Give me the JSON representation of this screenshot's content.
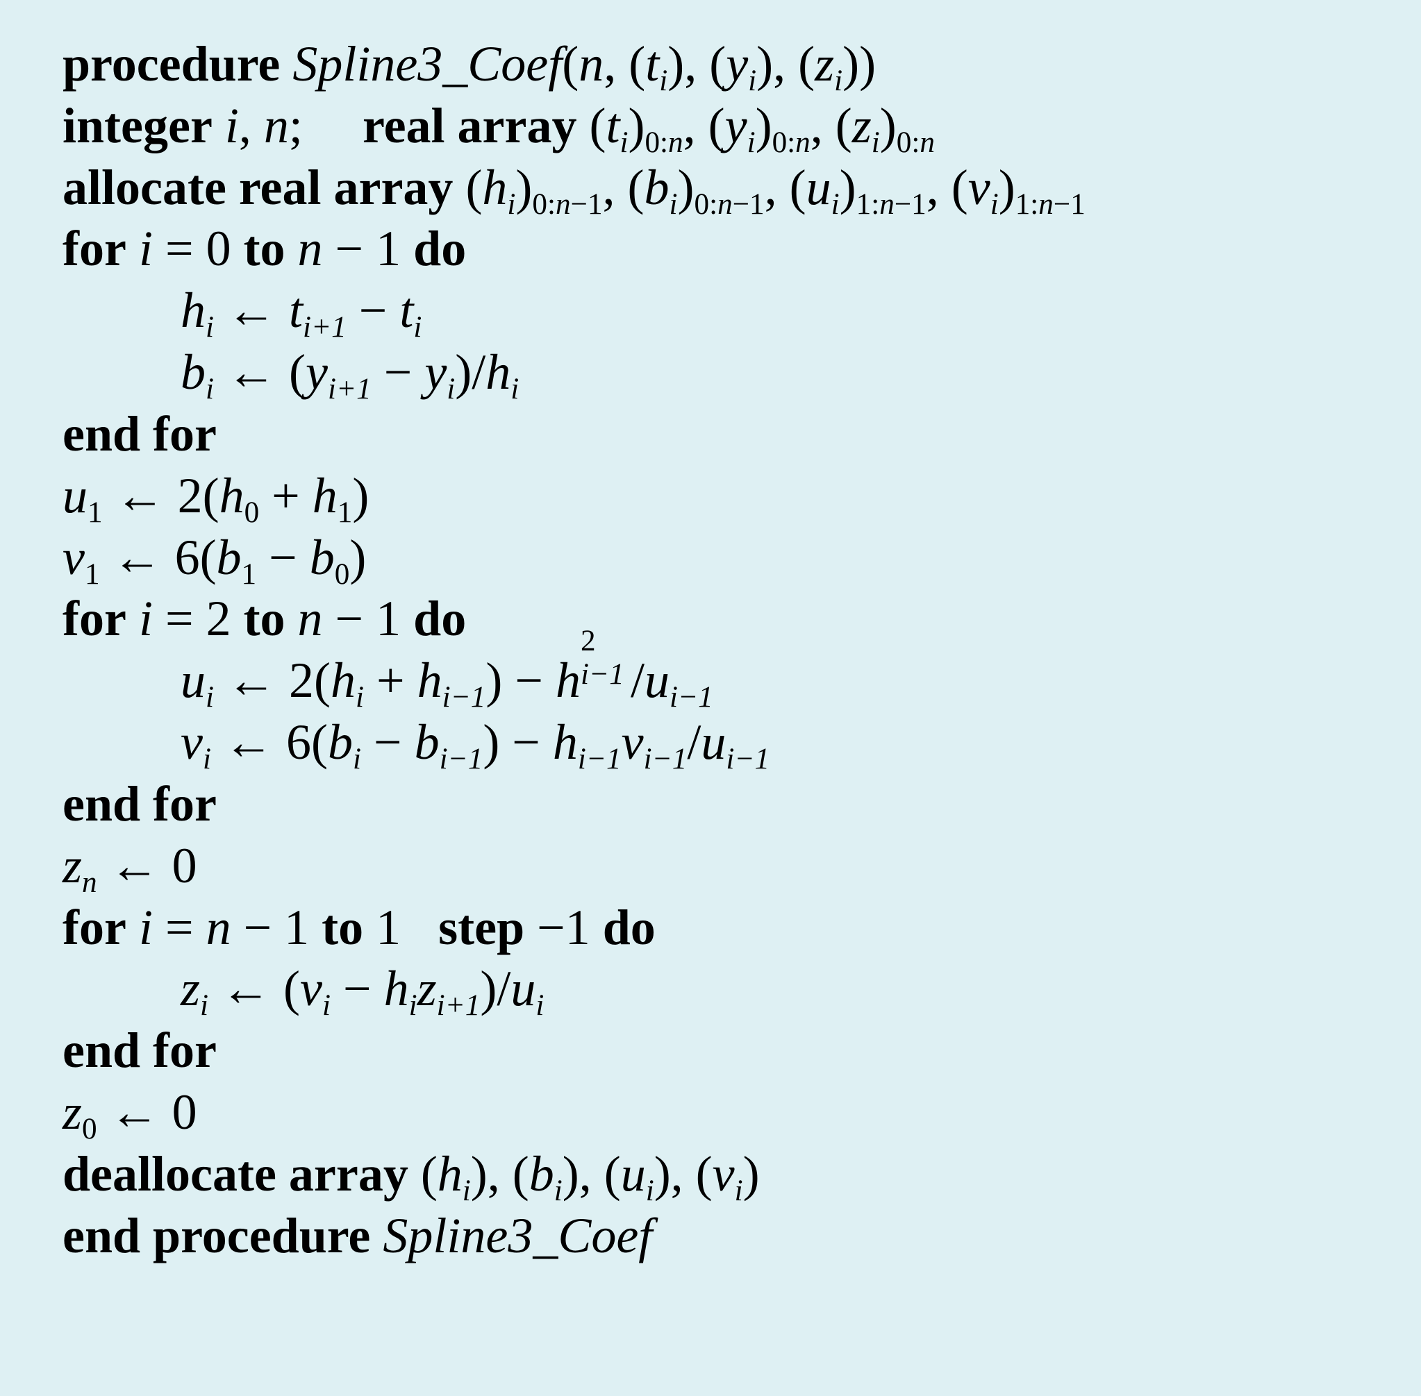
{
  "proc": {
    "kw_procedure": "procedure",
    "name": "Spline3_Coef",
    "sig_open": "(",
    "sig_n": "n",
    "sig_ti": "t",
    "sig_yi": "y",
    "sig_zi": "z",
    "idx_i": "i",
    "sig_close": ")"
  },
  "decl1": {
    "kw_integer": "integer",
    "vars": "i",
    "var_n": "n",
    "semi": ";",
    "kw_realarray": "real array",
    "a_t": "t",
    "a_y": "y",
    "a_z": "z",
    "sub_i": "i",
    "range0n": "0:n"
  },
  "decl2": {
    "kw_alloc": "allocate real array",
    "a_h": "h",
    "a_b": "b",
    "a_u": "u",
    "a_v": "v",
    "sub_i": "i",
    "range0n1": "0:n−1",
    "range1n1": "1:n−1"
  },
  "loop1": {
    "kw_for": "for",
    "var": "i",
    "eq": "=",
    "start": "0",
    "kw_to": "to",
    "end": "n − 1",
    "kw_do": "do",
    "body1_lhs": "h",
    "body1_sub": "i",
    "arrow": "←",
    "body1_rhs_a": "t",
    "body1_rhs_a_sub": "i+1",
    "minus": "−",
    "body1_rhs_b": "t",
    "body1_rhs_b_sub": "i",
    "body2_lhs": "b",
    "body2_sub": "i",
    "body2_rhs": "(y",
    "body2_rhs_a_sub": "i+1",
    "body2_rhs_mid": " − y",
    "body2_rhs_b_sub": "i",
    "body2_rhs_end": ")/h",
    "body2_rhs_h_sub": "i",
    "kw_endfor": "end for"
  },
  "init": {
    "u1_lhs": "u",
    "u1_sub": "1",
    "arrow": "←",
    "u1_rhs_a": "2(h",
    "u1_rhs_a_sub": "0",
    "u1_rhs_mid": " + h",
    "u1_rhs_b_sub": "1",
    "u1_rhs_end": ")",
    "v1_lhs": "v",
    "v1_sub": "1",
    "v1_rhs_a": "6(b",
    "v1_rhs_a_sub": "1",
    "v1_rhs_mid": " − b",
    "v1_rhs_b_sub": "0",
    "v1_rhs_end": ")"
  },
  "loop2": {
    "kw_for": "for",
    "var": "i",
    "eq": "=",
    "start": "2",
    "kw_to": "to",
    "end": "n − 1",
    "kw_do": "do",
    "u_lhs": "u",
    "u_sub": "i",
    "arrow": "←",
    "u_rhs_a": "2(h",
    "u_rhs_a_sub": "i",
    "u_rhs_mid": " + h",
    "u_rhs_b_sub": "i−1",
    "u_rhs_end1": ") − h",
    "u_rhs_sq_sub": "i−1",
    "u_rhs_sq_sup": "2",
    "u_rhs_div": "/u",
    "u_rhs_div_sub": "i−1",
    "v_lhs": "v",
    "v_sub": "i",
    "v_rhs_a": "6(b",
    "v_rhs_a_sub": "i",
    "v_rhs_mid": " − b",
    "v_rhs_b_sub": "i−1",
    "v_rhs_end1": ") − h",
    "v_rhs_h_sub": "i−1",
    "v_rhs_vmul": "v",
    "v_rhs_v_sub": "i−1",
    "v_rhs_div": "/u",
    "v_rhs_div_sub": "i−1",
    "kw_endfor": "end for"
  },
  "zn": {
    "lhs": "z",
    "sub": "n",
    "arrow": "←",
    "rhs": "0"
  },
  "loop3": {
    "kw_for": "for",
    "var": "i",
    "eq": "=",
    "start": "n − 1",
    "kw_to": "to",
    "end": "1",
    "kw_step": "step",
    "step_val": "−1",
    "kw_do": "do",
    "z_lhs": "z",
    "z_sub": "i",
    "arrow": "←",
    "z_rhs_a": "(v",
    "z_rhs_a_sub": "i",
    "z_rhs_mid": " − h",
    "z_rhs_h_sub": "i",
    "z_rhs_zmul": "z",
    "z_rhs_z_sub": "i+1",
    "z_rhs_end": ")/u",
    "z_rhs_u_sub": "i",
    "kw_endfor": "end for"
  },
  "z0": {
    "lhs": "z",
    "sub": "0",
    "arrow": "←",
    "rhs": "0"
  },
  "dealloc": {
    "kw": "deallocate array",
    "a_h": "h",
    "a_b": "b",
    "a_u": "u",
    "a_v": "v",
    "sub_i": "i"
  },
  "endproc": {
    "kw": "end procedure",
    "name": "Spline3_Coef"
  }
}
